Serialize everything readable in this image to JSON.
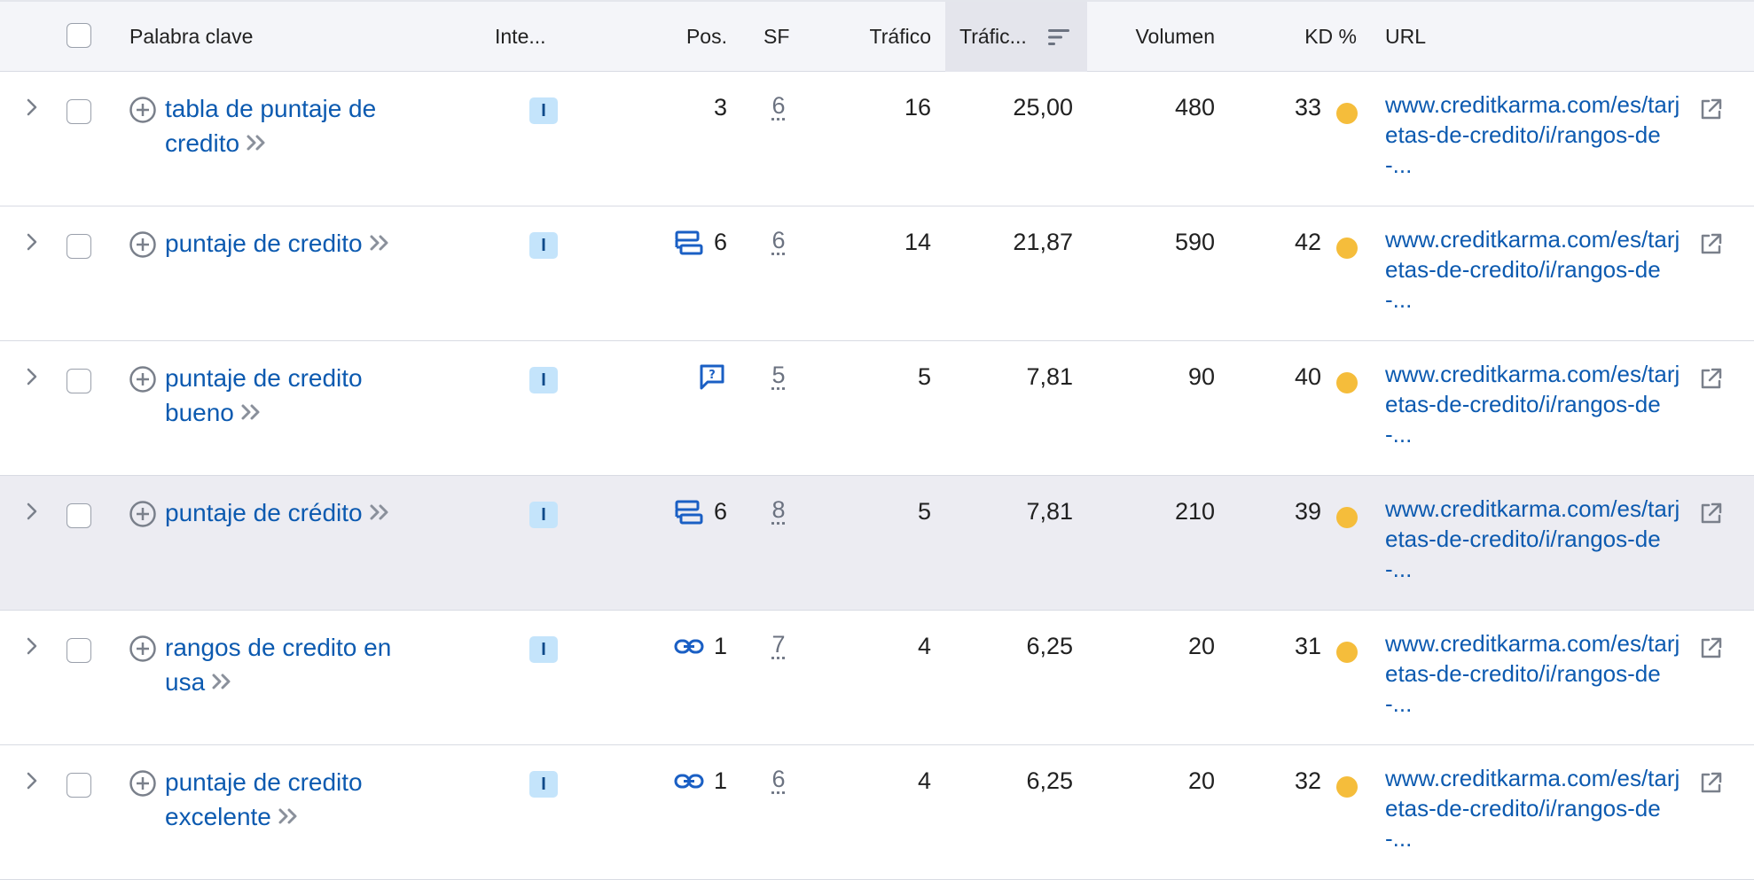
{
  "header": {
    "keyword": "Palabra clave",
    "intent": "Inte...",
    "position": "Pos.",
    "sf": "SF",
    "traffic": "Tráfico",
    "traffic_pct": "Tráfic...",
    "volume": "Volumen",
    "kd": "KD %",
    "url": "URL"
  },
  "colors": {
    "link": "#0c5ab0",
    "kd_dot": "#f5bd3b",
    "intent_bg": "#c4e4fb",
    "sorted_header": "#e4e5ec"
  },
  "rows": [
    {
      "keyword": "tabla de puntaje de credito",
      "intent": "I",
      "position": "3",
      "position_icon": "",
      "sf": "6",
      "traffic": "16",
      "traffic_pct": "25,00",
      "volume": "480",
      "kd": "33",
      "url": "www.creditkarma.com/es/tarjetas-de-credito/i/rangos-de-..."
    },
    {
      "keyword": "puntaje de credito",
      "intent": "I",
      "position": "6",
      "position_icon": "featured-snippet-icon",
      "sf": "6",
      "traffic": "14",
      "traffic_pct": "21,87",
      "volume": "590",
      "kd": "42",
      "url": "www.creditkarma.com/es/tarjetas-de-credito/i/rangos-de-..."
    },
    {
      "keyword": "puntaje de credito bueno",
      "intent": "I",
      "position": "",
      "position_icon": "people-also-ask-icon",
      "sf": "5",
      "traffic": "5",
      "traffic_pct": "7,81",
      "volume": "90",
      "kd": "40",
      "url": "www.creditkarma.com/es/tarjetas-de-credito/i/rangos-de-..."
    },
    {
      "keyword": "puntaje de crédito",
      "intent": "I",
      "position": "6",
      "position_icon": "featured-snippet-icon",
      "sf": "8",
      "traffic": "5",
      "traffic_pct": "7,81",
      "volume": "210",
      "kd": "39",
      "url": "www.creditkarma.com/es/tarjetas-de-credito/i/rangos-de-..."
    },
    {
      "keyword": "rangos de credito en usa",
      "intent": "I",
      "position": "1",
      "position_icon": "sitelinks-icon",
      "sf": "7",
      "traffic": "4",
      "traffic_pct": "6,25",
      "volume": "20",
      "kd": "31",
      "url": "www.creditkarma.com/es/tarjetas-de-credito/i/rangos-de-..."
    },
    {
      "keyword": "puntaje de credito excelente",
      "intent": "I",
      "position": "1",
      "position_icon": "sitelinks-icon",
      "sf": "6",
      "traffic": "4",
      "traffic_pct": "6,25",
      "volume": "20",
      "kd": "32",
      "url": "www.creditkarma.com/es/tarjetas-de-credito/i/rangos-de-..."
    }
  ]
}
